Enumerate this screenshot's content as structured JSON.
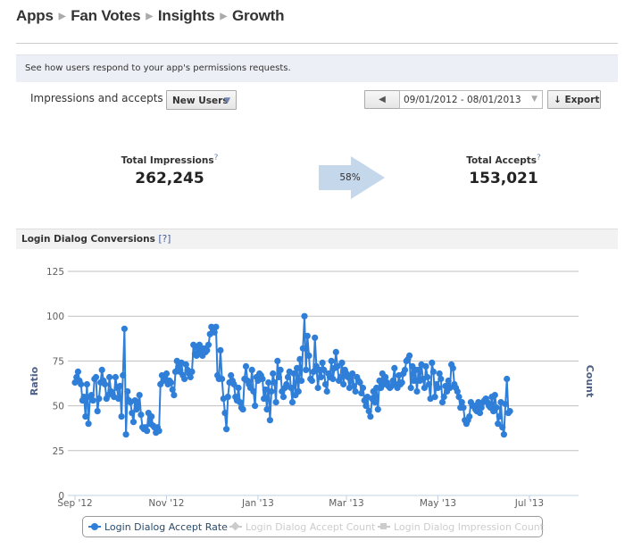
{
  "breadcrumb": [
    "Apps",
    "Fan Votes",
    "Insights",
    "Growth"
  ],
  "info_text": "See how users respond to your app's permissions requests.",
  "filter": {
    "label": "Impressions and accepts for",
    "selected": "New Users",
    "caret": "▼"
  },
  "date_range": {
    "prev_icon": "◀",
    "value": "09/01/2012 - 08/01/2013",
    "dropdown_icon": "▼"
  },
  "export": {
    "icon": "🡓",
    "label": "Export",
    "icon_text": "↓"
  },
  "stats": {
    "impressions": {
      "label": "Total Impressions",
      "help": "?",
      "value": "262,245"
    },
    "conversion": "58%",
    "accepts": {
      "label": "Total Accepts",
      "help": "?",
      "value": "153,021"
    }
  },
  "section": {
    "title": "Login Dialog Conversions",
    "help": "[?]"
  },
  "colors": {
    "series": "#2f7ed8",
    "grid": "#c0c0c0",
    "axis": "#c0d0e0",
    "arrow": "#c5d7ea",
    "disabled": "#cccccc"
  },
  "chart_data": {
    "type": "line",
    "title": "Login Dialog Conversions",
    "ylabel": "Ratio",
    "y2label": "Count",
    "ylim": [
      0,
      125
    ],
    "yticks": [
      0,
      25,
      50,
      75,
      100,
      125
    ],
    "x_start": "2012-09-01",
    "x_end": "2013-08-01",
    "xticks": [
      {
        "label": "Sep '12",
        "date": "2012-09-01"
      },
      {
        "label": "Nov '12",
        "date": "2012-11-01"
      },
      {
        "label": "Jan '13",
        "date": "2013-01-01"
      },
      {
        "label": "Mar '13",
        "date": "2013-03-01"
      },
      {
        "label": "May '13",
        "date": "2013-05-01"
      },
      {
        "label": "Jul '13",
        "date": "2013-07-01"
      }
    ],
    "legend": [
      {
        "name": "Login Dialog Accept Rate",
        "enabled": true,
        "marker": "circle"
      },
      {
        "name": "Login Dialog Accept Count",
        "enabled": false,
        "marker": "diamond"
      },
      {
        "name": "Login Dialog Impression Count",
        "enabled": false,
        "marker": "square"
      }
    ],
    "series": [
      {
        "name": "Login Dialog Accept Rate",
        "start_date": "2012-09-01",
        "interval_days": 1,
        "values": [
          63,
          66,
          69,
          64,
          62,
          53,
          55,
          44,
          62,
          40,
          55,
          56,
          53,
          65,
          66,
          47,
          54,
          63,
          70,
          64,
          62,
          54,
          56,
          66,
          58,
          57,
          55,
          66,
          60,
          54,
          61,
          44,
          67,
          93,
          34,
          58,
          53,
          52,
          46,
          41,
          53,
          48,
          50,
          56,
          45,
          38,
          37,
          38,
          36,
          46,
          40,
          44,
          39,
          38,
          35,
          38,
          36,
          62,
          67,
          64,
          66,
          68,
          62,
          64,
          63,
          59,
          56,
          69,
          75,
          72,
          69,
          74,
          67,
          65,
          73,
          70,
          68,
          66,
          69,
          84,
          79,
          78,
          82,
          84,
          80,
          78,
          82,
          80,
          81,
          84,
          90,
          94,
          93,
          91,
          94,
          67,
          65,
          81,
          65,
          54,
          46,
          37,
          55,
          63,
          67,
          64,
          62,
          55,
          53,
          60,
          52,
          49,
          48,
          65,
          72,
          64,
          62,
          60,
          70,
          58,
          50,
          66,
          64,
          68,
          67,
          65,
          54,
          59,
          48,
          63,
          42,
          58,
          68,
          63,
          52,
          75,
          66,
          70,
          58,
          55,
          60,
          62,
          66,
          69,
          60,
          52,
          68,
          56,
          71,
          58,
          76,
          64,
          82,
          100,
          70,
          89,
          78,
          65,
          64,
          69,
          88,
          72,
          60,
          70,
          66,
          74,
          70,
          62,
          58,
          68,
          66,
          75,
          65,
          71,
          80,
          72,
          64,
          66,
          74,
          62,
          70,
          68,
          66,
          60,
          64,
          68,
          61,
          58,
          66,
          64,
          63,
          57,
          60,
          53,
          50,
          55,
          47,
          44,
          54,
          58,
          52,
          60,
          48,
          64,
          60,
          68,
          62,
          66,
          63,
          61,
          60,
          61,
          64,
          71,
          62,
          60,
          67,
          62,
          63,
          68,
          70,
          75,
          76,
          78,
          60,
          72,
          64,
          70,
          58,
          70,
          64,
          73,
          65,
          60,
          72,
          66,
          62,
          54,
          74,
          69,
          55,
          62,
          60,
          68,
          65,
          52,
          55,
          61,
          58,
          64,
          60,
          73,
          71,
          62,
          60,
          58,
          55,
          49,
          52,
          49,
          42,
          40,
          42,
          44,
          52,
          50,
          50,
          48,
          47,
          52,
          46,
          49,
          52,
          53,
          54,
          52,
          50,
          49,
          55,
          47,
          56,
          49,
          40,
          44,
          52,
          38,
          34,
          51,
          65,
          46,
          47
        ]
      }
    ]
  }
}
